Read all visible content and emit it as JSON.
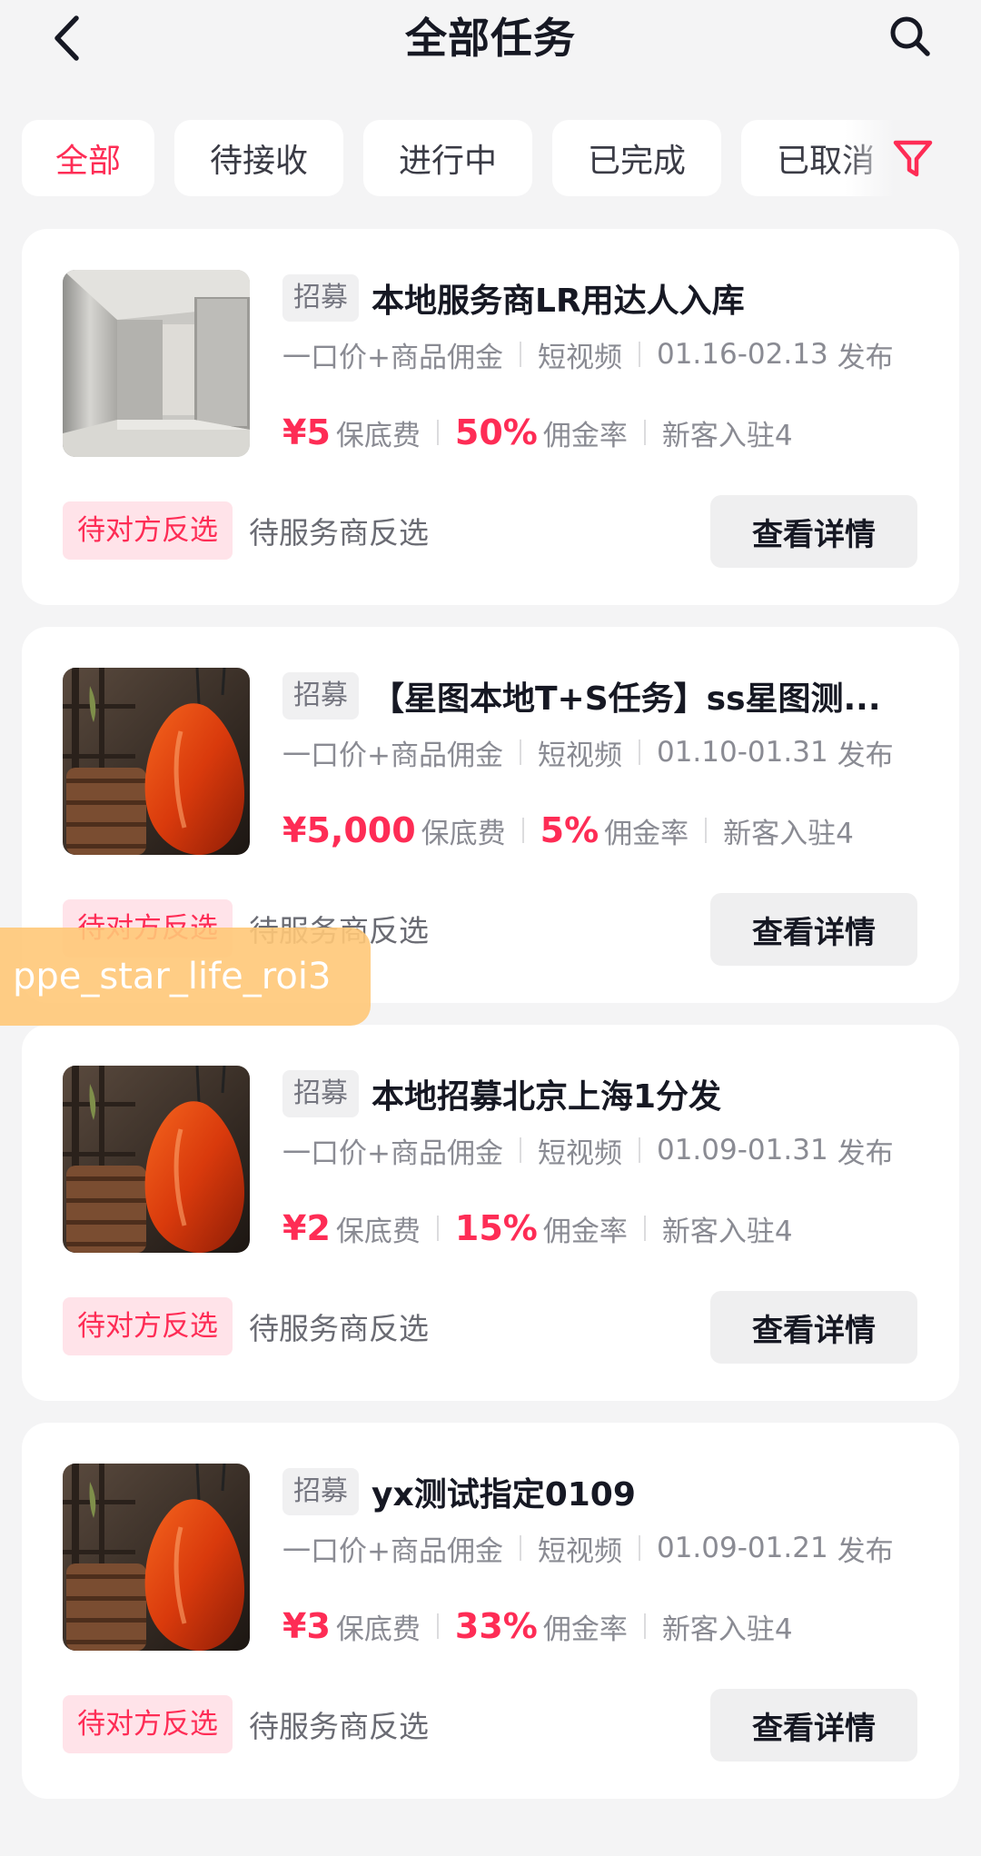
{
  "header": {
    "title": "全部任务"
  },
  "tabs": [
    "全部",
    "待接收",
    "进行中",
    "已完成",
    "已取消"
  ],
  "colors": {
    "accent": "#fe2c55",
    "background": "#f4f4f5",
    "card": "#ffffff"
  },
  "icons": {
    "back": "chevron-left-icon",
    "search": "search-icon",
    "filter": "filter-icon"
  },
  "labels": {
    "recruit_tag": "招募",
    "price_type": "一口价+商品佣金",
    "content_type": "短视频",
    "publish_suffix": "发布",
    "guarantee_label": "保底费",
    "commission_label": "佣金率",
    "new_client": "新客入驻4",
    "status_badge": "待对方反选",
    "status_text": "待服务商反选",
    "detail_button": "查看详情"
  },
  "tasks": [
    {
      "title": "本地服务商LR用达人入库",
      "date_range": "01.16-02.13",
      "guarantee": "¥5",
      "commission": "50%",
      "thumbnail": "hallway-photo"
    },
    {
      "title": "【星图本地T+S任务】ss星图测...",
      "date_range": "01.10-01.31",
      "guarantee": "¥5,000",
      "commission": "5%",
      "thumbnail": "roast-duck-photo"
    },
    {
      "title": "本地招募北京上海1分发",
      "date_range": "01.09-01.31",
      "guarantee": "¥2",
      "commission": "15%",
      "thumbnail": "roast-duck-photo"
    },
    {
      "title": "yx测试指定0109",
      "date_range": "01.09-01.21",
      "guarantee": "¥3",
      "commission": "33%",
      "thumbnail": "roast-duck-photo"
    }
  ],
  "debug_badge": "ppe_star_life_roi3"
}
